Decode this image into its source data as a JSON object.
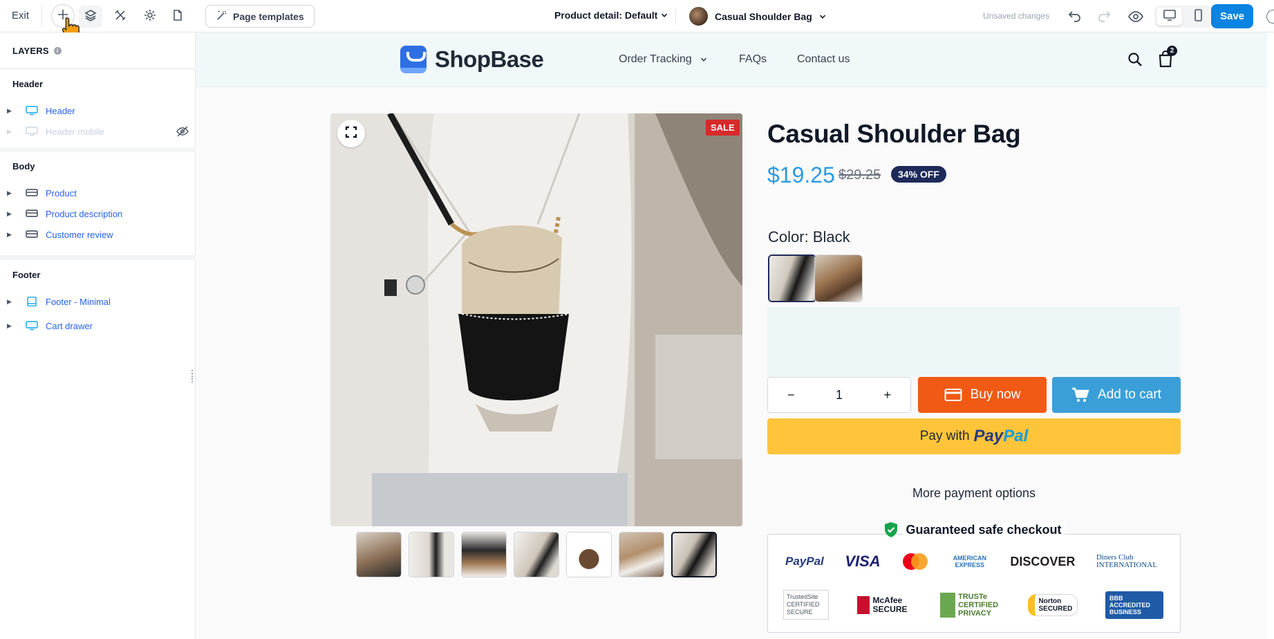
{
  "toolbar": {
    "exit_label": "Exit",
    "templates_label": "Page templates",
    "page_select": "Product detail: Default",
    "product_select": "Casual Shoulder Bag",
    "status": "Unsaved changes",
    "save_label": "Save",
    "icons": [
      "plus-icon",
      "layers-icon",
      "tools-icon",
      "gear-icon",
      "page-icon",
      "magic-wand-icon",
      "undo-icon",
      "redo-icon",
      "eye-icon",
      "desktop-icon",
      "mobile-icon"
    ]
  },
  "sidebar": {
    "title": "LAYERS",
    "sections": [
      {
        "name": "Header",
        "items": [
          {
            "label": "Header",
            "hidden": false
          },
          {
            "label": "Header mobile",
            "hidden": true
          }
        ]
      },
      {
        "name": "Body",
        "items": [
          {
            "label": "Product"
          },
          {
            "label": "Product description"
          },
          {
            "label": "Customer review"
          }
        ]
      },
      {
        "name": "Footer",
        "items": [
          {
            "label": "Footer - Minimal"
          },
          {
            "label": "Cart drawer"
          }
        ]
      }
    ]
  },
  "store": {
    "logo": "ShopBase",
    "nav": [
      "Order Tracking",
      "FAQs",
      "Contact us"
    ],
    "cart_count": "2"
  },
  "product": {
    "title": "Casual Shoulder Bag",
    "price": "$19.25",
    "compare_price": "$29.25",
    "discount_badge": "34% OFF",
    "sale_badge": "SALE",
    "color_label": "Color: Black",
    "quantity": "1",
    "qty_minus": "−",
    "qty_plus": "+",
    "buy_now": "Buy now",
    "add_to_cart": "Add to cart",
    "pay_with": "Pay with",
    "paypal_logo_a": "Pay",
    "paypal_logo_b": "Pal",
    "more_payment": "More payment options",
    "safe_checkout": "Guaranteed safe checkout",
    "payment_marks": [
      "PayPal",
      "VISA",
      "AMERICAN EXPRESS",
      "DISCOVER",
      "Diners Club INTERNATIONAL"
    ],
    "trust_marks": [
      "TrustedSite CERTIFIED SECURE",
      "McAfee SECURE",
      "TRUSTe CERTIFIED PRIVACY",
      "Norton SECURED",
      "BBB ACCREDITED BUSINESS"
    ]
  },
  "colors": {
    "accent": "#0a84e0",
    "price": "#2c9ae6",
    "buy_now": "#f05a14",
    "add_to_cart": "#3a9fd8",
    "paypal_button": "#ffc43a",
    "sale": "#d62a2a",
    "badge": "#1e2a5a"
  }
}
